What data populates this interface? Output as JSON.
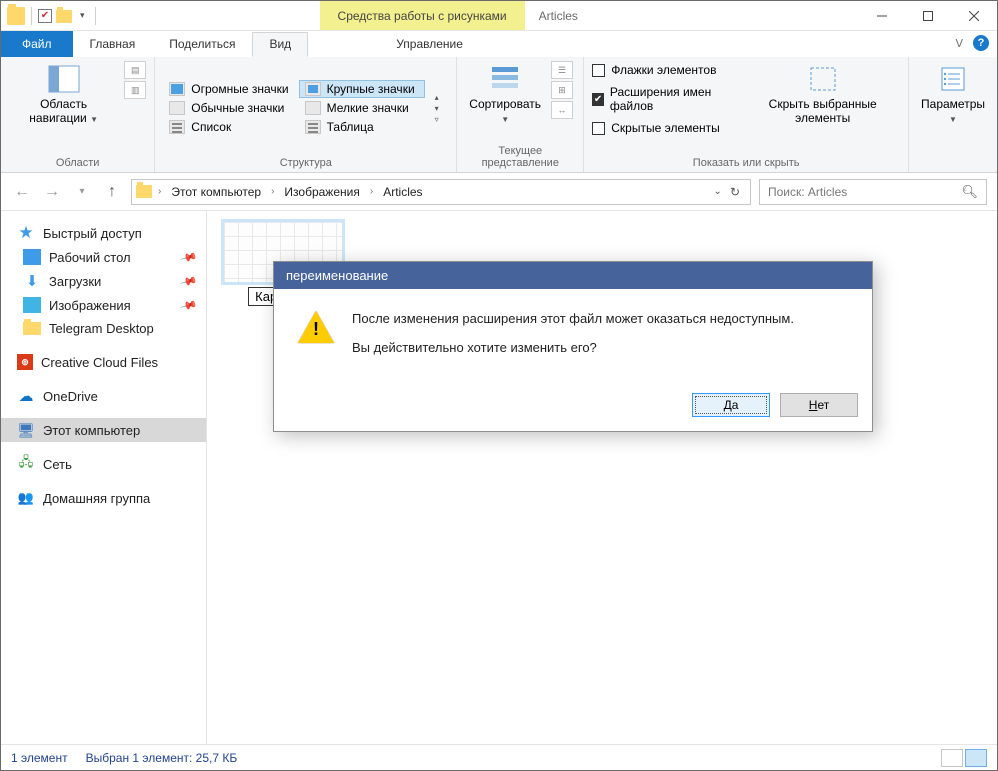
{
  "title": {
    "context_tools": "Средства работы с рисунками",
    "window": "Articles"
  },
  "tabs": {
    "file": "Файл",
    "home": "Главная",
    "share": "Поделиться",
    "view": "Вид",
    "manage": "Управление"
  },
  "ribbon": {
    "panes": {
      "nav_area": "Область навигации",
      "group": "Области"
    },
    "layout": {
      "huge": "Огромные значки",
      "large": "Крупные значки",
      "normal": "Обычные значки",
      "small": "Мелкие значки",
      "list": "Список",
      "table": "Таблица",
      "group": "Структура"
    },
    "current_view": {
      "sort": "Сортировать",
      "group": "Текущее представление"
    },
    "show_hide": {
      "item_checkboxes": "Флажки элементов",
      "file_ext": "Расширения имен файлов",
      "hidden": "Скрытые элементы",
      "hide_selected": "Скрыть выбранные элементы",
      "group": "Показать или скрыть"
    },
    "options": {
      "label": "Параметры"
    }
  },
  "breadcrumb": {
    "root": "Этот компьютер",
    "level1": "Изображения",
    "level2": "Articles"
  },
  "search": {
    "placeholder": "Поиск: Articles"
  },
  "sidebar": {
    "quick_access": "Быстрый доступ",
    "desktop": "Рабочий стол",
    "downloads": "Загрузки",
    "pictures": "Изображения",
    "telegram": "Telegram Desktop",
    "cc": "Creative Cloud Files",
    "onedrive": "OneDrive",
    "this_pc": "Этот компьютер",
    "network": "Сеть",
    "homegroup": "Домашняя группа"
  },
  "file": {
    "rename_value": "Карт"
  },
  "dialog": {
    "title": "переименование",
    "line1": "После изменения расширения этот файл может оказаться недоступным.",
    "line2": "Вы действительно хотите изменить его?",
    "yes": "Да",
    "no": "Нет"
  },
  "status": {
    "count": "1 элемент",
    "selection": "Выбран 1 элемент: 25,7 КБ"
  }
}
